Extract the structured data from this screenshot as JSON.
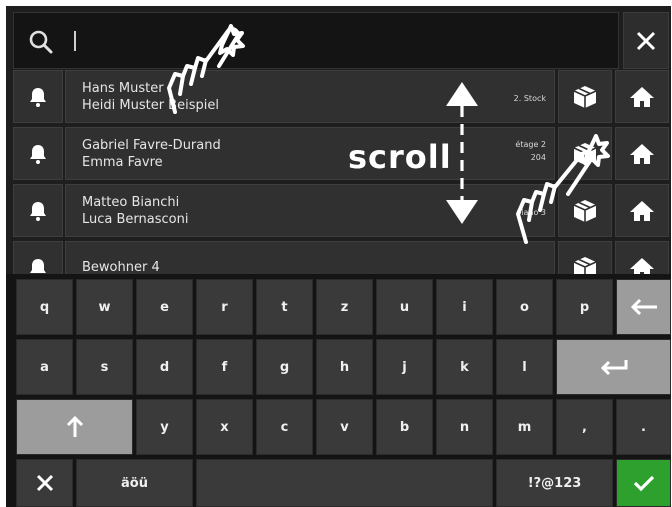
{
  "search": {
    "value": "",
    "icon": "search-icon"
  },
  "header": {
    "close_icon": "close-icon"
  },
  "residents": [
    {
      "line1": "Hans Muster",
      "line2": "Heidi Muster Beispiel",
      "floor1": "2. Stock",
      "floor2": ""
    },
    {
      "line1": "Gabriel Favre-Durand",
      "line2": "Emma Favre",
      "floor1": "étage 2",
      "floor2": "204"
    },
    {
      "line1": "Matteo Bianchi",
      "line2": "Luca Bernasconi",
      "floor1": "piano 3",
      "floor2": ""
    },
    {
      "line1": "Bewohner 4",
      "line2": "",
      "floor1": "",
      "floor2": ""
    }
  ],
  "annotation": {
    "scroll_label": "scroll"
  },
  "keyboard": {
    "row1": [
      "q",
      "w",
      "e",
      "r",
      "t",
      "z",
      "u",
      "i",
      "o",
      "p"
    ],
    "row2": [
      "a",
      "s",
      "d",
      "f",
      "g",
      "h",
      "j",
      "k",
      "l"
    ],
    "row3": [
      "y",
      "x",
      "c",
      "v",
      "b",
      "n",
      "m",
      ",",
      "."
    ],
    "umlaut_label": "äöü",
    "symbols_label": "!?@123",
    "space_label": ""
  },
  "colors": {
    "confirm_green": "#2ea02e",
    "panel_bg": "#1e1e1e"
  }
}
